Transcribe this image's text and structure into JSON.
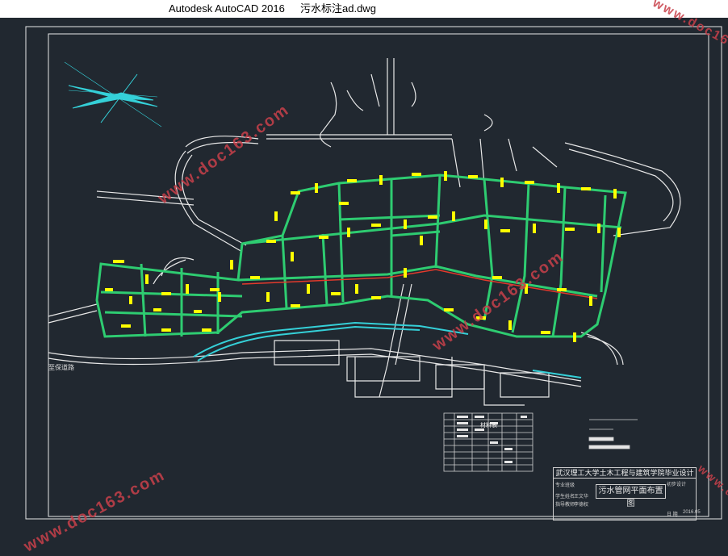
{
  "window": {
    "app_title": "Autodesk AutoCAD 2016",
    "file_name": "污水标注ad.dwg"
  },
  "drawing": {
    "road_label": "至保道路",
    "table_title": "材料表",
    "watermark": "www.doc163.com"
  },
  "title_block": {
    "header": "武汉理工大学土木工程与建筑学院毕业设计",
    "drawing_name": "污水管网平面布置图",
    "stage": "初步设计",
    "student_label": "学生姓名",
    "advisor_label": "指导教师",
    "review_label": "专业班级",
    "student_name": "王文华",
    "advisor_name": "李德权",
    "date_label": "日 期",
    "date": "2016.05"
  },
  "colors": {
    "background": "#212830",
    "pipe_green": "#2ecc71",
    "road_white": "#e8e8e8",
    "river_cyan": "#35d0d8",
    "label_yellow": "#ffff00",
    "main_red": "#e33a2c",
    "watermark_red": "#c8404a"
  }
}
